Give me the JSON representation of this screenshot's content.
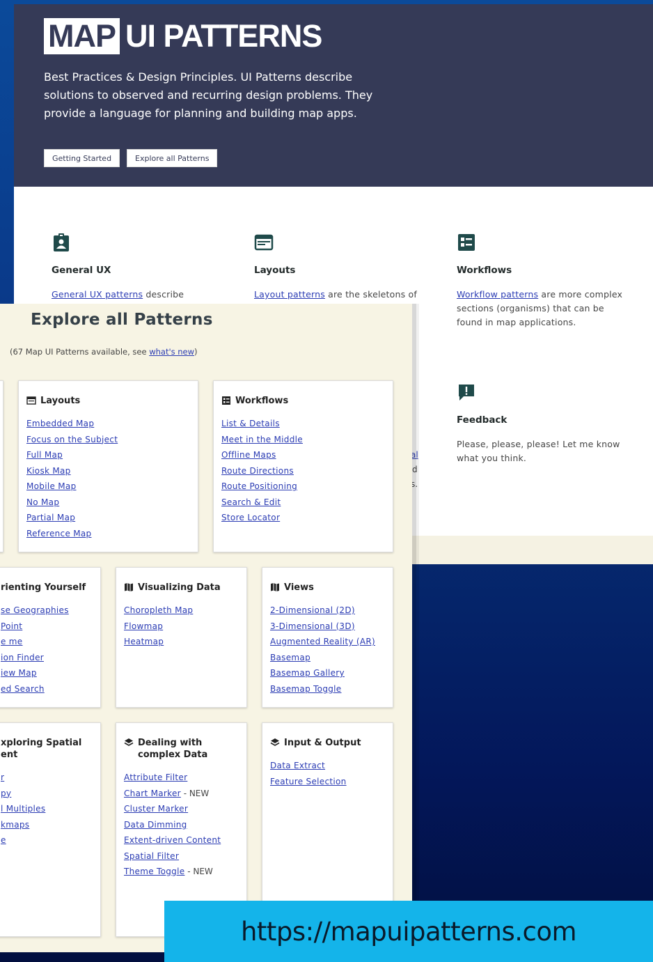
{
  "hero": {
    "logo_box": "MAP",
    "logo_rest": "UI PATTERNS",
    "description": "Best Practices & Design Principles. UI Patterns describe solutions to observed and recurring design problems. They provide a language for planning and building map apps.",
    "btn_getting_started": "Getting Started",
    "btn_explore": "Explore all Patterns"
  },
  "features": {
    "general_ux": {
      "title": "General UX",
      "link": "General UX patterns",
      "desc": " describe"
    },
    "layouts": {
      "title": "Layouts",
      "link": "Layout patterns",
      "desc": " are the skeletons of"
    },
    "workflows": {
      "title": "Workflows",
      "link": "Workflow patterns",
      "desc": " are more complex sections (organisms) that can be found in map applications."
    },
    "feedback": {
      "title": "Feedback",
      "desc": "Please, please, please! Let me know what you think."
    }
  },
  "fragments": {
    "f1": "al",
    "f2": "d",
    "f3": "s."
  },
  "explore": {
    "title": "Explore all Patterns",
    "subtitle_prefix": "(67 Map UI Patterns available, see ",
    "subtitle_link": "what's new",
    "subtitle_suffix": ")",
    "cards": {
      "layouts": {
        "title": "Layouts",
        "items": [
          "Embedded Map",
          "Focus on the Subject",
          "Full Map",
          "Kiosk Map",
          "Mobile Map",
          "No Map",
          "Partial Map",
          "Reference Map"
        ]
      },
      "workflows": {
        "title": "Workflows",
        "items": [
          "List & Details",
          "Meet in the Middle",
          "Offline Maps",
          "Route Directions",
          "Route Positioning",
          "Search & Edit",
          "Store Locator"
        ]
      },
      "orienting": {
        "title": "rienting Yourself",
        "items": [
          "se Geographies",
          "Point",
          "e me",
          "ion Finder",
          "iew Map",
          "ed Search"
        ]
      },
      "visualizing": {
        "title": "Visualizing Data",
        "items": [
          "Choropleth Map",
          "Flowmap",
          "Heatmap"
        ]
      },
      "views": {
        "title": "Views",
        "items": [
          "2-Dimensional (2D)",
          "3-Dimensional (3D)",
          "Augmented Reality (AR)",
          "Basemap",
          "Basemap Gallery",
          "Basemap Toggle"
        ]
      },
      "exploring": {
        "title": "xploring Spatial ent",
        "items": [
          "r",
          "py",
          "l Multiples",
          "kmaps",
          "e"
        ]
      },
      "dealing": {
        "title": "Dealing with complex Data",
        "items": [
          "Attribute Filter",
          "Chart Marker",
          "Cluster Marker",
          "Data Dimming",
          "Extent-driven Content",
          "Spatial Filter",
          "Theme Toggle"
        ],
        "new_tag": " - NEW"
      },
      "io": {
        "title": "Input & Output",
        "items": [
          "Data Extract",
          "Feature Selection"
        ]
      }
    }
  },
  "banner": {
    "url": "https://mapuipatterns.com"
  },
  "colors": {
    "hero_bg": "#353a57",
    "icon_teal": "#1f4a4a",
    "link": "#2a3bb3",
    "panel_bg": "#f7f4e4",
    "banner_bg": "#14b4ea"
  }
}
